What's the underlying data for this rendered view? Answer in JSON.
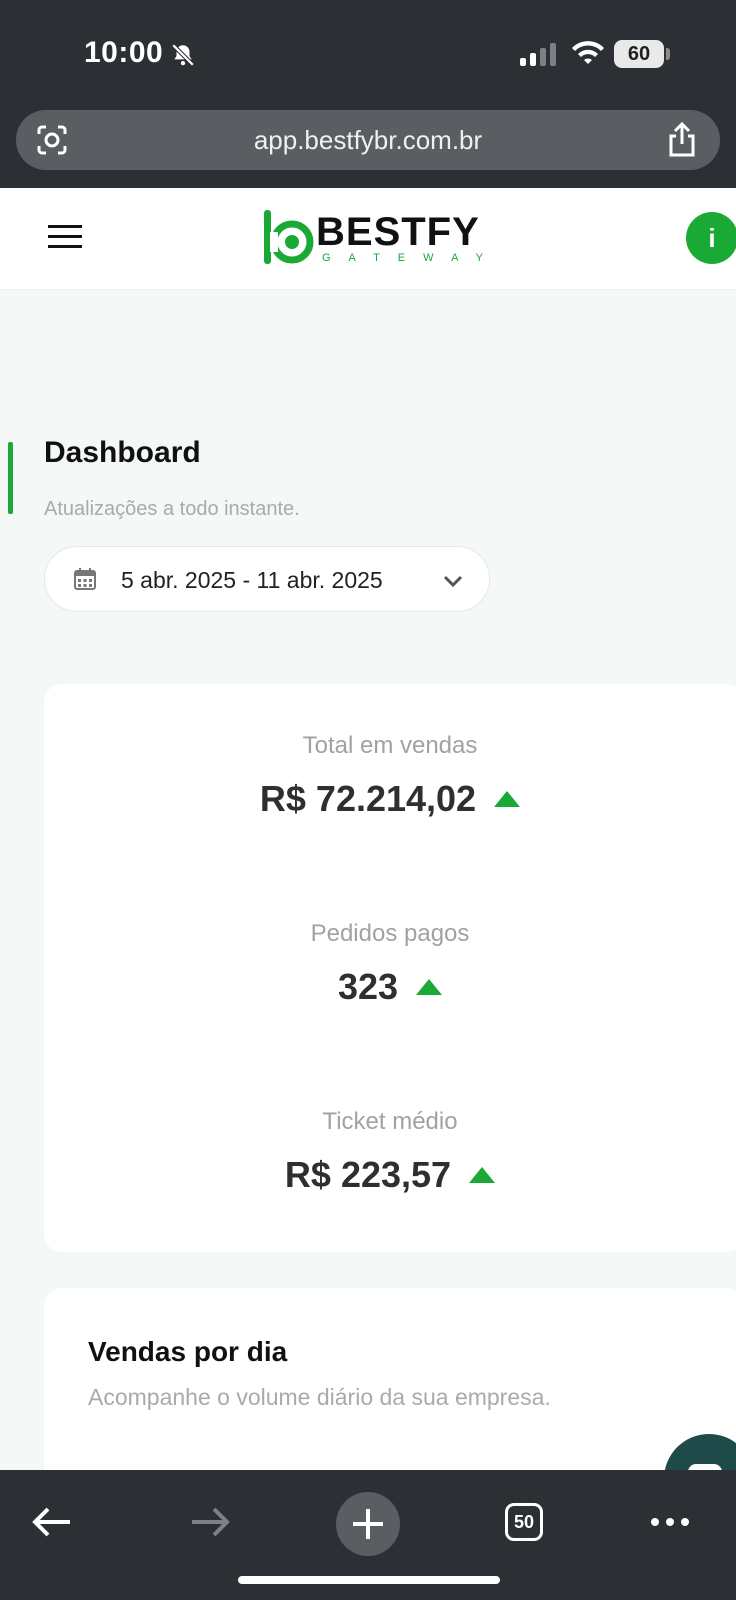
{
  "status_bar": {
    "time": "10:00",
    "battery": "60",
    "icons": [
      "bell-slash-icon",
      "signal-icon",
      "wifi-icon",
      "battery-icon"
    ]
  },
  "browser": {
    "url": "app.bestfybr.com.br",
    "tab_count": "50",
    "icons": [
      "lens-icon",
      "share-icon",
      "back-arrow-icon",
      "forward-arrow-icon",
      "plus-icon",
      "tabs-icon",
      "more-icon"
    ]
  },
  "header": {
    "brand_name": "BESTFY",
    "brand_tagline": "GATEWAY",
    "avatar_initial": "i",
    "colors": {
      "brand_green": "#1ba936",
      "text_dark": "#111111"
    }
  },
  "page": {
    "title": "Dashboard",
    "subtitle": "Atualizações a todo instante.",
    "date_range": "5 abr. 2025 - 11 abr. 2025"
  },
  "metrics": [
    {
      "label": "Total em vendas",
      "value": "R$ 72.214,02",
      "trend": "up"
    },
    {
      "label": "Pedidos pagos",
      "value": "323",
      "trend": "up"
    },
    {
      "label": "Ticket médio",
      "value": "R$ 223,57",
      "trend": "up"
    }
  ],
  "sales_card": {
    "title": "Vendas por dia",
    "subtitle": "Acompanhe o volume diário da sua empresa."
  }
}
